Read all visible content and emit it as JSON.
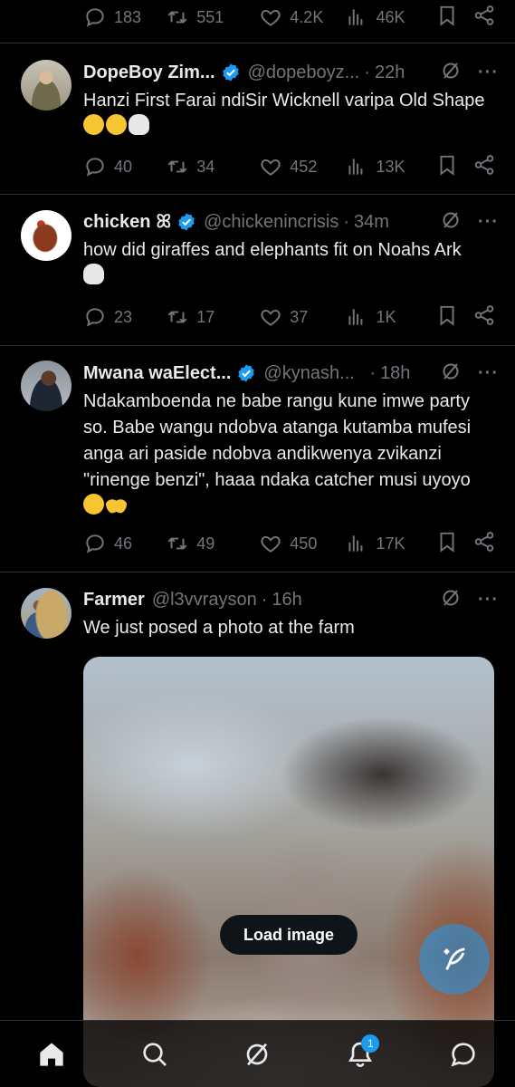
{
  "top_actions": {
    "replies": "183",
    "reposts": "551",
    "likes": "4.2K",
    "views": "46K"
  },
  "tweets": [
    {
      "name": "DopeBoy Zim...",
      "verified": true,
      "handle": "@dopeboyz...",
      "time": "22h",
      "text": "Hanzi First Farai ndiSir Wicknell varipa Old Shape",
      "emojis": [
        "laugh-cry-emoji",
        "fearful-emoji",
        "skull-emoji"
      ],
      "replies": "40",
      "reposts": "34",
      "likes": "452",
      "views": "13K"
    },
    {
      "name": "chicken",
      "name_symbol": "ꕤ",
      "verified": true,
      "handle": "@chickenincrisis",
      "time": "34m",
      "text": "how did giraffes and elephants fit on Noahs Ark",
      "emojis": [
        "skull-emoji"
      ],
      "replies": "23",
      "reposts": "17",
      "likes": "37",
      "views": "1K"
    },
    {
      "name": "Mwana waElect...",
      "verified": true,
      "handle": "@kynash...",
      "time": "18h",
      "text": "Ndakamboenda ne babe rangu kune imwe party so. Babe wangu ndobva atanga kutamba mufesi anga ari paside ndobva andikwenya zvikanzi \"rinenge benzi\", haaa ndaka catcher musi uyoyo",
      "emojis": [
        "sobbing-emoji",
        "raised-hands-emoji"
      ],
      "replies": "46",
      "reposts": "49",
      "likes": "450",
      "views": "17K"
    },
    {
      "name": "Farmer",
      "verified": false,
      "handle": "@l3vvrayson",
      "time": "16h",
      "text": "We just posed a photo at the farm",
      "load_image_label": "Load image"
    }
  ],
  "separator": "·",
  "more_label": "···",
  "nav": {
    "items": [
      "home-icon",
      "search-icon",
      "grok-icon",
      "notifications-icon",
      "messages-icon"
    ],
    "notification_count": "1"
  },
  "colors": {
    "accent": "#1d9bf0",
    "muted": "#71767b",
    "text": "#e7e9ea",
    "background": "#000000"
  }
}
